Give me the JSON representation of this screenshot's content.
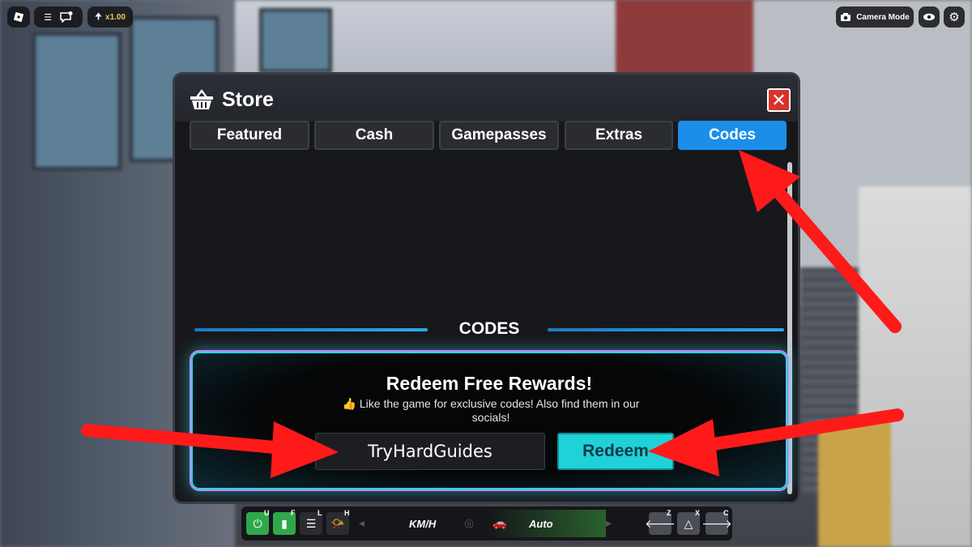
{
  "hud": {
    "multiplier": "x1.00",
    "camera_mode": "Camera Mode"
  },
  "store": {
    "title": "Store",
    "tabs": [
      {
        "label": "Featured",
        "active": false
      },
      {
        "label": "Cash",
        "active": false
      },
      {
        "label": "Gamepasses",
        "active": false
      },
      {
        "label": "Extras",
        "active": false
      },
      {
        "label": "Codes",
        "active": true
      }
    ],
    "section_heading": "CODES",
    "card": {
      "title": "Redeem Free Rewards!",
      "subtitle": "👍 Like the game for exclusive codes! Also find them in our socials!",
      "input_value": "TryHardGuides",
      "redeem_label": "Redeem"
    }
  },
  "vehicle_hud": {
    "keys": [
      "U",
      "F",
      "L",
      "H",
      "Z",
      "X",
      "C"
    ],
    "speed_unit": "KM/H",
    "transmission": "Auto"
  },
  "colors": {
    "active_tab": "#1a8ee8",
    "close_button": "#d8332a",
    "redeem_button": "#1fd2d8",
    "card_glow_cyan": "#25d6e8",
    "card_glow_purple": "#c08af5",
    "annotation_arrow": "#ff1a1a"
  }
}
